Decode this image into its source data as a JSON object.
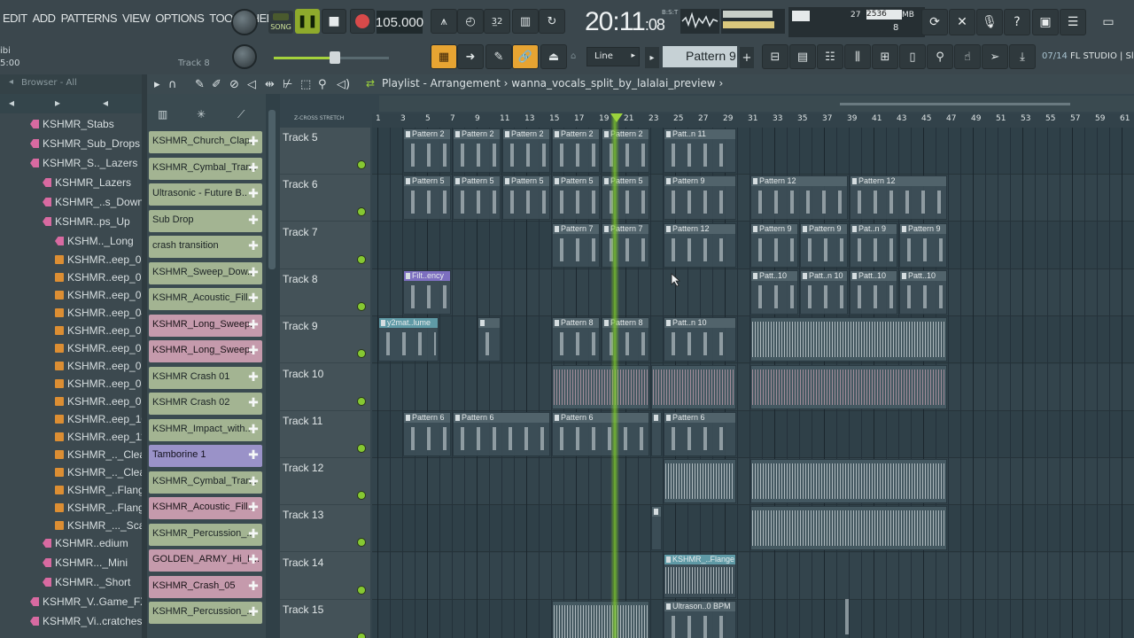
{
  "menu": [
    "EDIT",
    "ADD",
    "PATTERNS",
    "VIEW",
    "OPTIONS",
    "TOOLS",
    "HELP"
  ],
  "hint_left_top": "ibi",
  "hint_left_time": "5:00",
  "track_hint": "Track 8",
  "transport": {
    "mode_label": "SONG",
    "mode_pat": "PAT",
    "tempo": "105.000",
    "clock": "20:11",
    "clock_frac": ":08",
    "clock_unit": "B:S:T"
  },
  "cpu": {
    "value": "27",
    "memory": "2536",
    "memory_unit": "MB",
    "polyphony": "8"
  },
  "snap": {
    "value": "Line",
    "arrow": "▸"
  },
  "pattern": {
    "current": "Pattern 9",
    "add": "+",
    "prev": "▸"
  },
  "hint_bar": {
    "page": "07/14",
    "text": "FL STUDIO | Slic"
  },
  "browser": {
    "title": "Browser - All",
    "items": [
      {
        "label": "KSHMR_Stabs",
        "kind": "folder",
        "indent": 34
      },
      {
        "label": "KSHMR_Sub_Drops",
        "kind": "folder",
        "indent": 34
      },
      {
        "label": "KSHMR_S.._Lazers",
        "kind": "folder",
        "indent": 34
      },
      {
        "label": "KSHMR_Lazers",
        "kind": "folder",
        "indent": 48
      },
      {
        "label": "KSHMR_..s_Down",
        "kind": "folder",
        "indent": 48
      },
      {
        "label": "KSHMR..ps_Up",
        "kind": "folder",
        "indent": 48
      },
      {
        "label": "KSHM.._Long",
        "kind": "folder",
        "indent": 62
      },
      {
        "label": "KSHMR..eep_01",
        "kind": "file",
        "indent": 62
      },
      {
        "label": "KSHMR..eep_02",
        "kind": "file",
        "indent": 62
      },
      {
        "label": "KSHMR..eep_03",
        "kind": "file",
        "indent": 62
      },
      {
        "label": "KSHMR..eep_04",
        "kind": "file",
        "indent": 62
      },
      {
        "label": "KSHMR..eep_05",
        "kind": "file",
        "indent": 62
      },
      {
        "label": "KSHMR..eep_06",
        "kind": "file",
        "indent": 62
      },
      {
        "label": "KSHMR..eep_07",
        "kind": "file",
        "indent": 62
      },
      {
        "label": "KSHMR..eep_08",
        "kind": "file",
        "indent": 62
      },
      {
        "label": "KSHMR..eep_09",
        "kind": "file",
        "indent": 62
      },
      {
        "label": "KSHMR..eep_10",
        "kind": "file",
        "indent": 62
      },
      {
        "label": "KSHMR..eep_11",
        "kind": "file",
        "indent": 62
      },
      {
        "label": "KSHMR_.._Clean",
        "kind": "file",
        "indent": 62
      },
      {
        "label": "KSHMR_.._Clean",
        "kind": "file",
        "indent": 62
      },
      {
        "label": "KSHMR_..Flange",
        "kind": "file",
        "indent": 62
      },
      {
        "label": "KSHMR_..Flange",
        "kind": "file",
        "indent": 62
      },
      {
        "label": "KSHMR_..._Scary",
        "kind": "file",
        "indent": 62
      },
      {
        "label": "KSHMR..edium",
        "kind": "folder",
        "indent": 48
      },
      {
        "label": "KSHMR..._Mini",
        "kind": "folder",
        "indent": 48
      },
      {
        "label": "KSHMR.._Short",
        "kind": "folder",
        "indent": 48
      },
      {
        "label": "KSHMR_V..Game_FX",
        "kind": "folder",
        "indent": 34
      },
      {
        "label": "KSHMR_Vi..cratches",
        "kind": "folder",
        "indent": 34
      }
    ]
  },
  "channels": [
    {
      "label": "KSHMR_Church_Clap..",
      "color": "green"
    },
    {
      "label": "KSHMR_Cymbal_Tran..",
      "color": "green"
    },
    {
      "label": "Ultrasonic - Future B..",
      "color": "green"
    },
    {
      "label": "Sub Drop",
      "color": "green"
    },
    {
      "label": "crash transition",
      "color": "green"
    },
    {
      "label": "KSHMR_Sweep_Dow..",
      "color": "green"
    },
    {
      "label": "KSHMR_Acoustic_Fill..",
      "color": "green"
    },
    {
      "label": "KSHMR_Long_Sweep..",
      "color": "pink"
    },
    {
      "label": "KSHMR_Long_Sweep..",
      "color": "pink"
    },
    {
      "label": "KSHMR Crash 01",
      "color": "green"
    },
    {
      "label": "KSHMR Crash 02",
      "color": "green"
    },
    {
      "label": "KSHMR_Impact_with..",
      "color": "green"
    },
    {
      "label": "Tamborine 1",
      "color": "purple"
    },
    {
      "label": "KSHMR_Cymbal_Tran..",
      "color": "green"
    },
    {
      "label": "KSHMR_Acoustic_Fill..",
      "color": "pink"
    },
    {
      "label": "KSHMR_Percussion_..",
      "color": "green"
    },
    {
      "label": "GOLDEN_ARMY_Hi_H..",
      "color": "pink"
    },
    {
      "label": "KSHMR_Crash_05",
      "color": "pink"
    },
    {
      "label": "KSHMR_Percussion_..",
      "color": "green"
    }
  ],
  "playlist": {
    "title": "Playlist - Arrangement",
    "separator": "›",
    "project": "wanna_vocals_split_by_lalalai_preview",
    "ruler_labels": "Z-CROSS  STRETCH",
    "ruler_ticks": [
      "1",
      "3",
      "5",
      "7",
      "9",
      "11",
      "13",
      "15",
      "17",
      "19",
      "21",
      "23",
      "25",
      "27",
      "29",
      "31",
      "33",
      "35",
      "37",
      "39",
      "41",
      "43",
      "45",
      "47",
      "49",
      "51",
      "53",
      "55",
      "57",
      "59",
      "61"
    ],
    "tracks": [
      "Track 5",
      "Track 6",
      "Track 7",
      "Track 8",
      "Track 9",
      "Track 10",
      "Track 11",
      "Track 12",
      "Track 13",
      "Track 14",
      "Track 15"
    ],
    "clips": [
      {
        "track": 0,
        "start": 3,
        "len": 4,
        "label": "Pattern 2",
        "kind": "pattern"
      },
      {
        "track": 0,
        "start": 7,
        "len": 4,
        "label": "Pattern 2",
        "kind": "pattern"
      },
      {
        "track": 0,
        "start": 11,
        "len": 4,
        "label": "Pattern 2",
        "kind": "pattern"
      },
      {
        "track": 0,
        "start": 15,
        "len": 4,
        "label": "Pattern 2",
        "kind": "pattern"
      },
      {
        "track": 0,
        "start": 19,
        "len": 4,
        "label": "Pattern 2",
        "kind": "pattern"
      },
      {
        "track": 0,
        "start": 24,
        "len": 6,
        "label": "Patt..n 11",
        "kind": "pattern"
      },
      {
        "track": 1,
        "start": 3,
        "len": 4,
        "label": "Pattern 5",
        "kind": "pattern"
      },
      {
        "track": 1,
        "start": 7,
        "len": 4,
        "label": "Pattern 5",
        "kind": "pattern"
      },
      {
        "track": 1,
        "start": 11,
        "len": 4,
        "label": "Pattern 5",
        "kind": "pattern"
      },
      {
        "track": 1,
        "start": 15,
        "len": 4,
        "label": "Pattern 5",
        "kind": "pattern"
      },
      {
        "track": 1,
        "start": 19,
        "len": 4,
        "label": "Pattern 5",
        "kind": "pattern"
      },
      {
        "track": 1,
        "start": 24,
        "len": 6,
        "label": "Pattern 9",
        "kind": "pattern"
      },
      {
        "track": 1,
        "start": 31,
        "len": 8,
        "label": "Pattern 12",
        "kind": "pattern"
      },
      {
        "track": 1,
        "start": 39,
        "len": 8,
        "label": "Pattern 12",
        "kind": "pattern"
      },
      {
        "track": 2,
        "start": 15,
        "len": 4,
        "label": "Pattern 7",
        "kind": "pattern"
      },
      {
        "track": 2,
        "start": 19,
        "len": 4,
        "label": "Pattern 7",
        "kind": "pattern"
      },
      {
        "track": 2,
        "start": 24,
        "len": 6,
        "label": "Pattern 12",
        "kind": "pattern"
      },
      {
        "track": 2,
        "start": 31,
        "len": 4,
        "label": "Pattern 9",
        "kind": "pattern"
      },
      {
        "track": 2,
        "start": 35,
        "len": 4,
        "label": "Pattern 9",
        "kind": "pattern"
      },
      {
        "track": 2,
        "start": 39,
        "len": 4,
        "label": "Pat..n 9",
        "kind": "pattern"
      },
      {
        "track": 2,
        "start": 43,
        "len": 4,
        "label": "Pattern 9",
        "kind": "pattern"
      },
      {
        "track": 3,
        "start": 3,
        "len": 4,
        "label": "Filt..ency",
        "kind": "purple"
      },
      {
        "track": 3,
        "start": 31,
        "len": 4,
        "label": "Patt..10",
        "kind": "pattern"
      },
      {
        "track": 3,
        "start": 35,
        "len": 4,
        "label": "Patt..n 10",
        "kind": "pattern"
      },
      {
        "track": 3,
        "start": 39,
        "len": 4,
        "label": "Patt..10",
        "kind": "pattern"
      },
      {
        "track": 3,
        "start": 43,
        "len": 4,
        "label": "Patt..10",
        "kind": "pattern"
      },
      {
        "track": 4,
        "start": 1,
        "len": 5,
        "label": "y2mat..lume",
        "kind": "teal"
      },
      {
        "track": 4,
        "start": 9,
        "len": 2,
        "label": "",
        "kind": "pattern"
      },
      {
        "track": 4,
        "start": 15,
        "len": 4,
        "label": "Pattern 8",
        "kind": "pattern"
      },
      {
        "track": 4,
        "start": 19,
        "len": 4,
        "label": "Pattern 8",
        "kind": "pattern"
      },
      {
        "track": 4,
        "start": 24,
        "len": 6,
        "label": "Patt..n 10",
        "kind": "pattern"
      },
      {
        "track": 4,
        "start": 31,
        "len": 16,
        "label": "",
        "kind": "audio"
      },
      {
        "track": 5,
        "start": 15,
        "len": 8,
        "label": "",
        "kind": "audio"
      },
      {
        "track": 5,
        "start": 23,
        "len": 7,
        "label": "",
        "kind": "audio"
      },
      {
        "track": 5,
        "start": 31,
        "len": 16,
        "label": "",
        "kind": "audio"
      },
      {
        "track": 6,
        "start": 3,
        "len": 4,
        "label": "Pattern 6",
        "kind": "pattern"
      },
      {
        "track": 6,
        "start": 7,
        "len": 8,
        "label": "Pattern 6",
        "kind": "pattern"
      },
      {
        "track": 6,
        "start": 15,
        "len": 8,
        "label": "Pattern 6",
        "kind": "pattern"
      },
      {
        "track": 6,
        "start": 23,
        "len": 1,
        "label": "",
        "kind": "pattern"
      },
      {
        "track": 6,
        "start": 24,
        "len": 6,
        "label": "Pattern 6",
        "kind": "pattern"
      },
      {
        "track": 7,
        "start": 24,
        "len": 6,
        "label": "",
        "kind": "audio"
      },
      {
        "track": 7,
        "start": 31,
        "len": 16,
        "label": "",
        "kind": "audio"
      },
      {
        "track": 8,
        "start": 23,
        "len": 1,
        "label": "",
        "kind": "pattern"
      },
      {
        "track": 8,
        "start": 31,
        "len": 16,
        "label": "",
        "kind": "audio"
      },
      {
        "track": 9,
        "start": 24,
        "len": 6,
        "label": "KSHMR_..Flange",
        "kind": "teal"
      },
      {
        "track": 10,
        "start": 15,
        "len": 8,
        "label": "",
        "kind": "audio"
      },
      {
        "track": 10,
        "start": 24,
        "len": 6,
        "label": "Ultrason..0 BPM",
        "kind": "pattern"
      }
    ]
  },
  "colors": {
    "accent": "#86c832",
    "playhead": "#8fd23a",
    "pink": "#c59aac",
    "purple": "#9a92c8",
    "green": "#a3b492"
  }
}
